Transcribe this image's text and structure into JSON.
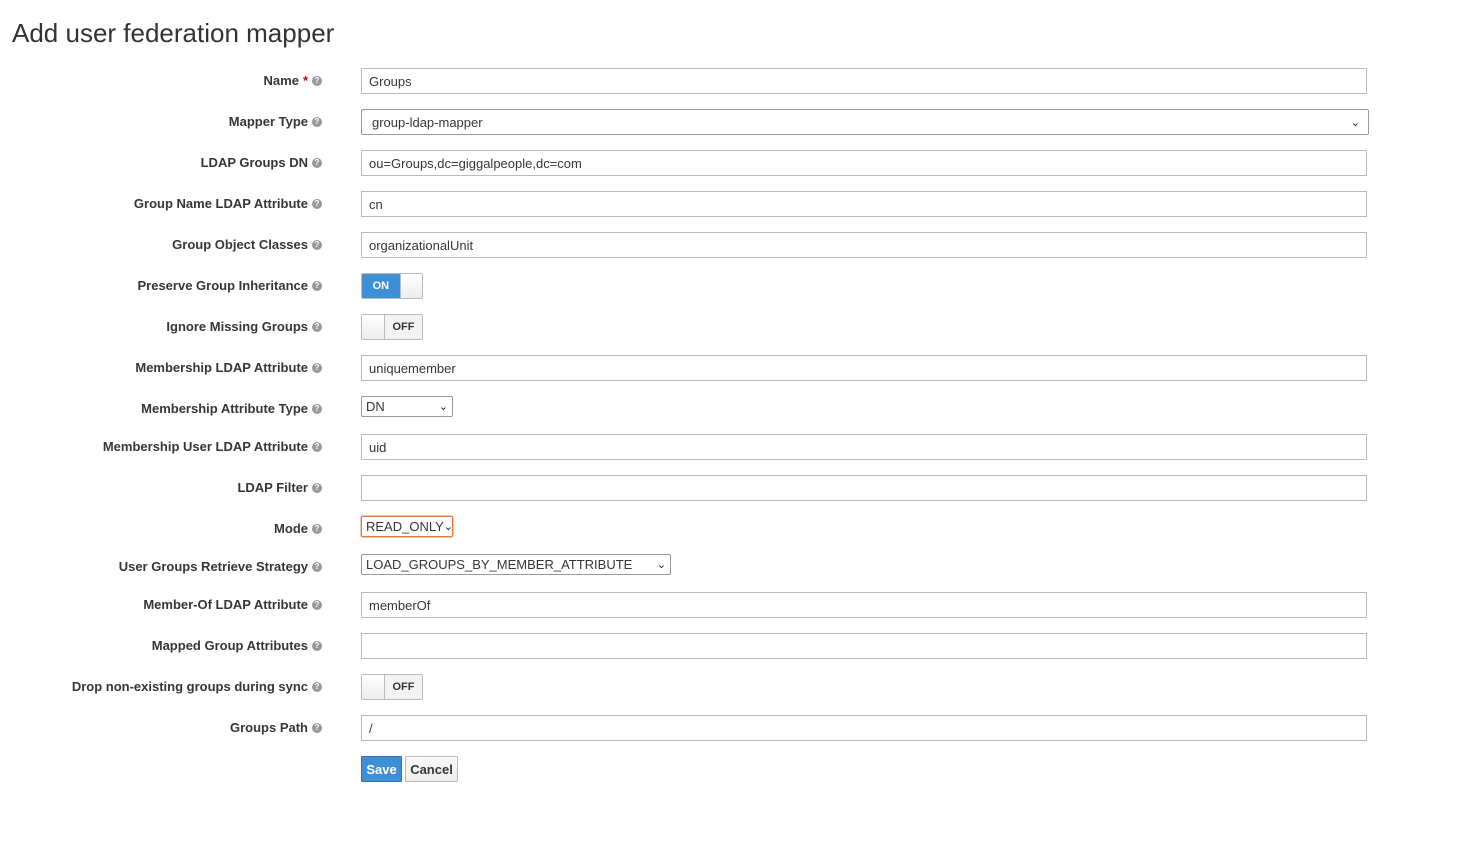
{
  "page": {
    "title": "Add user federation mapper"
  },
  "fields": {
    "name": {
      "label": "Name",
      "required_mark": "*",
      "value": "Groups"
    },
    "mapper_type": {
      "label": "Mapper Type",
      "value": "group-ldap-mapper"
    },
    "ldap_groups_dn": {
      "label": "LDAP Groups DN",
      "value": "ou=Groups,dc=giggalpeople,dc=com"
    },
    "group_name_attr": {
      "label": "Group Name LDAP Attribute",
      "value": "cn"
    },
    "group_object_classes": {
      "label": "Group Object Classes",
      "value": "organizationalUnit"
    },
    "preserve_inheritance": {
      "label": "Preserve Group Inheritance",
      "state": "ON"
    },
    "ignore_missing": {
      "label": "Ignore Missing Groups",
      "state": "OFF"
    },
    "membership_attr": {
      "label": "Membership LDAP Attribute",
      "value": "uniquemember"
    },
    "membership_attr_type": {
      "label": "Membership Attribute Type",
      "value": "DN"
    },
    "membership_user_attr": {
      "label": "Membership User LDAP Attribute",
      "value": "uid"
    },
    "ldap_filter": {
      "label": "LDAP Filter",
      "value": ""
    },
    "mode": {
      "label": "Mode",
      "value": "READ_ONLY"
    },
    "retrieve_strategy": {
      "label": "User Groups Retrieve Strategy",
      "value": "LOAD_GROUPS_BY_MEMBER_ATTRIBUTE"
    },
    "member_of_attr": {
      "label": "Member-Of LDAP Attribute",
      "value": "memberOf"
    },
    "mapped_group_attrs": {
      "label": "Mapped Group Attributes",
      "value": ""
    },
    "drop_nonexisting": {
      "label": "Drop non-existing groups during sync",
      "state": "OFF"
    },
    "groups_path": {
      "label": "Groups Path",
      "value": "/"
    }
  },
  "buttons": {
    "save": "Save",
    "cancel": "Cancel"
  },
  "icons": {
    "help": "question-circle-icon",
    "caret": "chevron-down-icon"
  },
  "colors": {
    "primary": "#3f8fd6",
    "focus_border": "#e07b3a",
    "required": "#cc0000"
  }
}
